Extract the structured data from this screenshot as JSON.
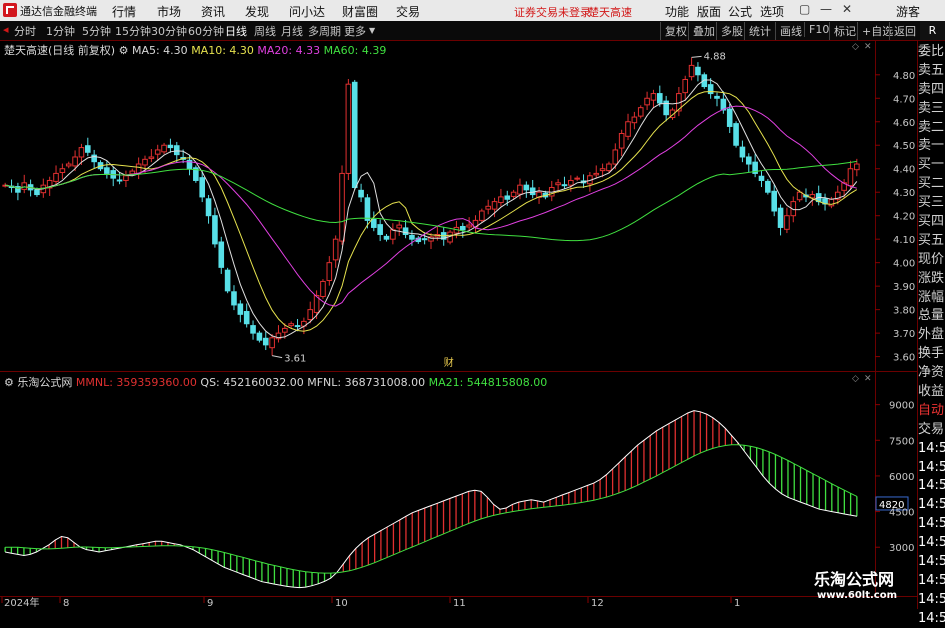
{
  "menubar": {
    "app_name": "通达信金融终端",
    "items": [
      "行情",
      "市场",
      "资讯",
      "发现",
      "问小达",
      "财富圈",
      "交易"
    ],
    "warning": "证券交易未登录",
    "stock": "楚天高速",
    "right_items": [
      "功能",
      "版面",
      "公式",
      "选项"
    ],
    "user": "游客"
  },
  "toolbar": {
    "periods": [
      "分时",
      "1分钟",
      "5分钟",
      "15分钟",
      "30分钟",
      "60分钟",
      "日线",
      "周线",
      "月线",
      "多周期",
      "更多"
    ],
    "active": "日线",
    "right": [
      "复权",
      "叠加",
      "多股",
      "统计",
      "画线",
      "F10",
      "标记",
      "+自选",
      "返回"
    ],
    "tab_r": "R"
  },
  "main_legend": {
    "title": "楚天高速(日线 前复权)",
    "ma5": "MA5: 4.30",
    "ma10": "MA10: 4.30",
    "ma20": "MA20: 4.33",
    "ma60": "MA60: 4.39"
  },
  "sub_legend": {
    "title": "乐淘公式网",
    "mmnl": "MMNL: 359359360.00",
    "qs": "QS: 452160032.00",
    "mfnl": "MFNL: 368731008.00",
    "ma21": "MA21: 544815808.00"
  },
  "sidebar": [
    "委比",
    "卖五",
    "卖四",
    "卖三",
    "卖二",
    "卖一",
    "买一",
    "买二",
    "买三",
    "买四",
    "买五",
    "现价",
    "涨跌",
    "涨幅",
    "总量",
    "外盘",
    "换手",
    "净资",
    "收益",
    "自动",
    "交易",
    "14:56",
    "14:56",
    "14:56",
    "14:56",
    "14:56",
    "14:56",
    "14:56",
    "14:56",
    "14:56",
    "14:56"
  ],
  "chart_data": [
    {
      "type": "candlestick",
      "yaxis_ticks": [
        "4.80",
        "4.70",
        "4.60",
        "4.50",
        "4.40",
        "4.30",
        "4.20",
        "4.10",
        "4.00",
        "3.90",
        "3.80",
        "3.70",
        "3.60"
      ],
      "ylim": [
        3.56,
        4.88
      ],
      "annotations": {
        "high": "4.88",
        "low": "3.61",
        "marker": "财"
      },
      "colors": {
        "up": "#e03030",
        "down": "#58e0e8",
        "ma5": "#e0e0e0",
        "ma10": "#e6e24e",
        "ma20": "#e040e0",
        "ma60": "#40e040"
      },
      "close": [
        4.33,
        4.32,
        4.3,
        4.34,
        4.31,
        4.29,
        4.33,
        4.35,
        4.38,
        4.4,
        4.42,
        4.45,
        4.49,
        4.47,
        4.43,
        4.4,
        4.38,
        4.36,
        4.35,
        4.37,
        4.39,
        4.42,
        4.44,
        4.45,
        4.48,
        4.5,
        4.49,
        4.46,
        4.44,
        4.4,
        4.35,
        4.28,
        4.2,
        4.08,
        3.98,
        3.88,
        3.82,
        3.78,
        3.74,
        3.7,
        3.67,
        3.65,
        3.68,
        3.7,
        3.72,
        3.74,
        3.73,
        3.75,
        3.8,
        3.86,
        3.92,
        4.0,
        4.1,
        4.38,
        4.76,
        4.32,
        4.28,
        4.18,
        4.15,
        4.12,
        4.1,
        4.14,
        4.16,
        4.12,
        4.1,
        4.09,
        4.1,
        4.11,
        4.12,
        4.1,
        4.13,
        4.15,
        4.14,
        4.16,
        4.18,
        4.22,
        4.24,
        4.26,
        4.28,
        4.27,
        4.3,
        4.33,
        4.31,
        4.29,
        4.3,
        4.28,
        4.32,
        4.34,
        4.33,
        4.35,
        4.36,
        4.34,
        4.37,
        4.38,
        4.4,
        4.42,
        4.48,
        4.55,
        4.6,
        4.62,
        4.66,
        4.7,
        4.72,
        4.68,
        4.63,
        4.65,
        4.72,
        4.78,
        4.84,
        4.8,
        4.75,
        4.72,
        4.7,
        4.65,
        4.58,
        4.5,
        4.45,
        4.42,
        4.38,
        4.35,
        4.3,
        4.22,
        4.15,
        4.2,
        4.26,
        4.3,
        4.28,
        4.29,
        4.26,
        4.25,
        4.27,
        4.3,
        4.34,
        4.4,
        4.42
      ]
    },
    {
      "type": "bar",
      "yaxis_ticks": [
        "9000",
        "7500",
        "6000",
        "4820",
        "4500",
        "3000"
      ],
      "current_value": "4820",
      "xaxis_ticks": [
        "2024年",
        "8",
        "9",
        "10",
        "11",
        "12",
        "1"
      ],
      "colors": {
        "pos": "#e03030",
        "neg": "#40e040",
        "line1": "#ffffff",
        "line2": "#40e040"
      },
      "series": [
        {
          "name": "MMNL",
          "values": [
            2800,
            2750,
            2700,
            2650,
            2700,
            2800,
            2950,
            3100,
            3300,
            3450,
            3400,
            3200,
            3000,
            2900,
            2850,
            2800,
            2850,
            2900,
            2950,
            3000,
            3050,
            3100,
            3150,
            3200,
            3250,
            3250,
            3200,
            3150,
            3100,
            3000,
            2900,
            2750,
            2600,
            2450,
            2300,
            2150,
            2050,
            1950,
            1850,
            1750,
            1650,
            1550,
            1500,
            1450,
            1400,
            1350,
            1320,
            1300,
            1320,
            1380,
            1460,
            1560,
            1700,
            1950,
            2300,
            2650,
            2950,
            3200,
            3400,
            3550,
            3700,
            3850,
            4000,
            4150,
            4300,
            4450,
            4550,
            4650,
            4750,
            4850,
            4950,
            5050,
            5150,
            5250,
            5350,
            5400,
            5350,
            5100,
            4800,
            4600,
            4650,
            4800,
            4900,
            4950,
            5000,
            4950,
            4900,
            5000,
            5100,
            5200,
            5300,
            5400,
            5500,
            5600,
            5700,
            5850,
            6050,
            6300,
            6550,
            6800,
            7050,
            7300,
            7500,
            7700,
            7900,
            8050,
            8200,
            8350,
            8500,
            8650,
            8750,
            8700,
            8600,
            8450,
            8250,
            8000,
            7700,
            7400,
            7050,
            6700,
            6350,
            6000,
            5700,
            5450,
            5250,
            5100,
            5000,
            4900,
            4800,
            4700,
            4600,
            4550,
            4500,
            4450,
            4400,
            4350,
            4300
          ]
        },
        {
          "name": "MA21",
          "values": [
            3000,
            3000,
            3000,
            2980,
            2960,
            2940,
            2930,
            2930,
            2940,
            2960,
            2980,
            3000,
            3010,
            3010,
            3000,
            2990,
            2980,
            2980,
            2990,
            3000,
            3010,
            3020,
            3030,
            3040,
            3050,
            3060,
            3060,
            3060,
            3050,
            3040,
            3020,
            2990,
            2950,
            2900,
            2840,
            2780,
            2710,
            2640,
            2570,
            2500,
            2430,
            2360,
            2290,
            2230,
            2170,
            2110,
            2060,
            2010,
            1970,
            1940,
            1920,
            1910,
            1910,
            1930,
            1960,
            2010,
            2080,
            2160,
            2250,
            2350,
            2460,
            2570,
            2680,
            2790,
            2900,
            3010,
            3120,
            3230,
            3340,
            3450,
            3560,
            3670,
            3780,
            3890,
            4000,
            4100,
            4190,
            4270,
            4340,
            4400,
            4450,
            4500,
            4540,
            4580,
            4620,
            4650,
            4680,
            4710,
            4740,
            4770,
            4800,
            4840,
            4880,
            4930,
            4980,
            5040,
            5110,
            5190,
            5280,
            5380,
            5490,
            5610,
            5740,
            5870,
            6000,
            6140,
            6280,
            6420,
            6560,
            6700,
            6840,
            6960,
            7070,
            7160,
            7230,
            7280,
            7310,
            7310,
            7290,
            7250,
            7190,
            7110,
            7010,
            6900,
            6780,
            6650,
            6510,
            6370,
            6230,
            6090,
            5950,
            5810,
            5670,
            5530,
            5400,
            5270,
            5140
          ]
        }
      ]
    }
  ]
}
